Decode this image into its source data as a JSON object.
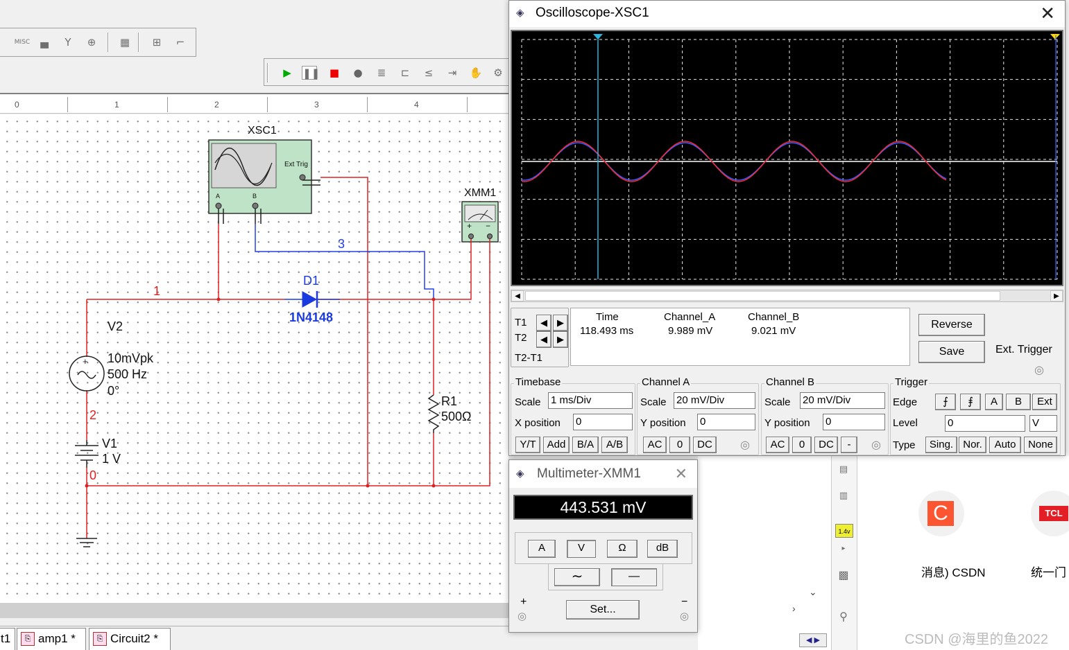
{
  "toolbar": {
    "misc_label": "MISC"
  },
  "ruler": {
    "marks": [
      "0",
      "1",
      "2",
      "3",
      "4"
    ]
  },
  "schematic": {
    "scope_label": "XSC1",
    "scope_ext_trig": "Ext Trig",
    "scope_a": "A",
    "scope_b": "B",
    "dmm_label": "XMM1",
    "dmm_plus": "+",
    "dmm_minus": "−",
    "diode_ref": "D1",
    "diode_model": "1N4148",
    "net1": "1",
    "net2": "2",
    "net3": "3",
    "net0": "0",
    "v2_name": "V2",
    "v2_amp": "10mVpk",
    "v2_freq": "500 Hz",
    "v2_phase": "0°",
    "v1_name": "V1",
    "v1_value": "1 V",
    "r1_name": "R1",
    "r1_value": "500Ω"
  },
  "tabs": [
    {
      "label": "t1"
    },
    {
      "label": "amp1 *"
    },
    {
      "label": "Circuit2 *"
    }
  ],
  "oscilloscope": {
    "title": "Oscilloscope-XSC1",
    "readout_headers": {
      "time": "Time",
      "cha": "Channel_A",
      "chb": "Channel_B"
    },
    "t1_label": "T1",
    "t2_label": "T2",
    "t2t1_label": "T2-T1",
    "t1_time": "118.493 ms",
    "t1_cha": "9.989 mV",
    "t1_chb": "9.021 mV",
    "reverse_btn": "Reverse",
    "save_btn": "Save",
    "ext_trigger": "Ext. Trigger",
    "timebase": {
      "title": "Timebase",
      "scale_label": "Scale",
      "scale_value": "1 ms/Div",
      "xpos_label": "X position",
      "xpos_value": "0",
      "buttons": [
        "Y/T",
        "Add",
        "B/A",
        "A/B"
      ]
    },
    "channel_a": {
      "title": "Channel A",
      "scale_label": "Scale",
      "scale_value": "20 mV/Div",
      "ypos_label": "Y position",
      "ypos_value": "0",
      "buttons": [
        "AC",
        "0",
        "DC"
      ]
    },
    "channel_b": {
      "title": "Channel B",
      "scale_label": "Scale",
      "scale_value": "20 mV/Div",
      "ypos_label": "Y position",
      "ypos_value": "0",
      "buttons": [
        "AC",
        "0",
        "DC",
        "-"
      ]
    },
    "trigger": {
      "title": "Trigger",
      "edge_label": "Edge",
      "edge_buttons": [
        "⨍",
        "⨎",
        "A",
        "B",
        "Ext"
      ],
      "level_label": "Level",
      "level_value": "0",
      "level_unit": "V",
      "type_label": "Type",
      "type_buttons": [
        "Sing.",
        "Nor.",
        "Auto",
        "None"
      ]
    },
    "colors": {
      "channel_a": "#ff2a2a",
      "channel_b": "#3a5bff",
      "cursor": "#2ab5e0"
    }
  },
  "multimeter": {
    "title": "Multimeter-XMM1",
    "reading": "443.531 mV",
    "mode_buttons": [
      "A",
      "V",
      "Ω",
      "dB"
    ],
    "ac_symbol": "∼",
    "dc_symbol": "—",
    "set_button": "Set...",
    "plus": "+",
    "minus": "−"
  },
  "desktop": {
    "csdn_label": "消息) CSDN",
    "tcl_label": "统一门",
    "tcl_logo": "TCL",
    "csdn_logo": "C",
    "watermark": "CSDN @海里的鱼2022",
    "meter_tag": "1.4v"
  }
}
